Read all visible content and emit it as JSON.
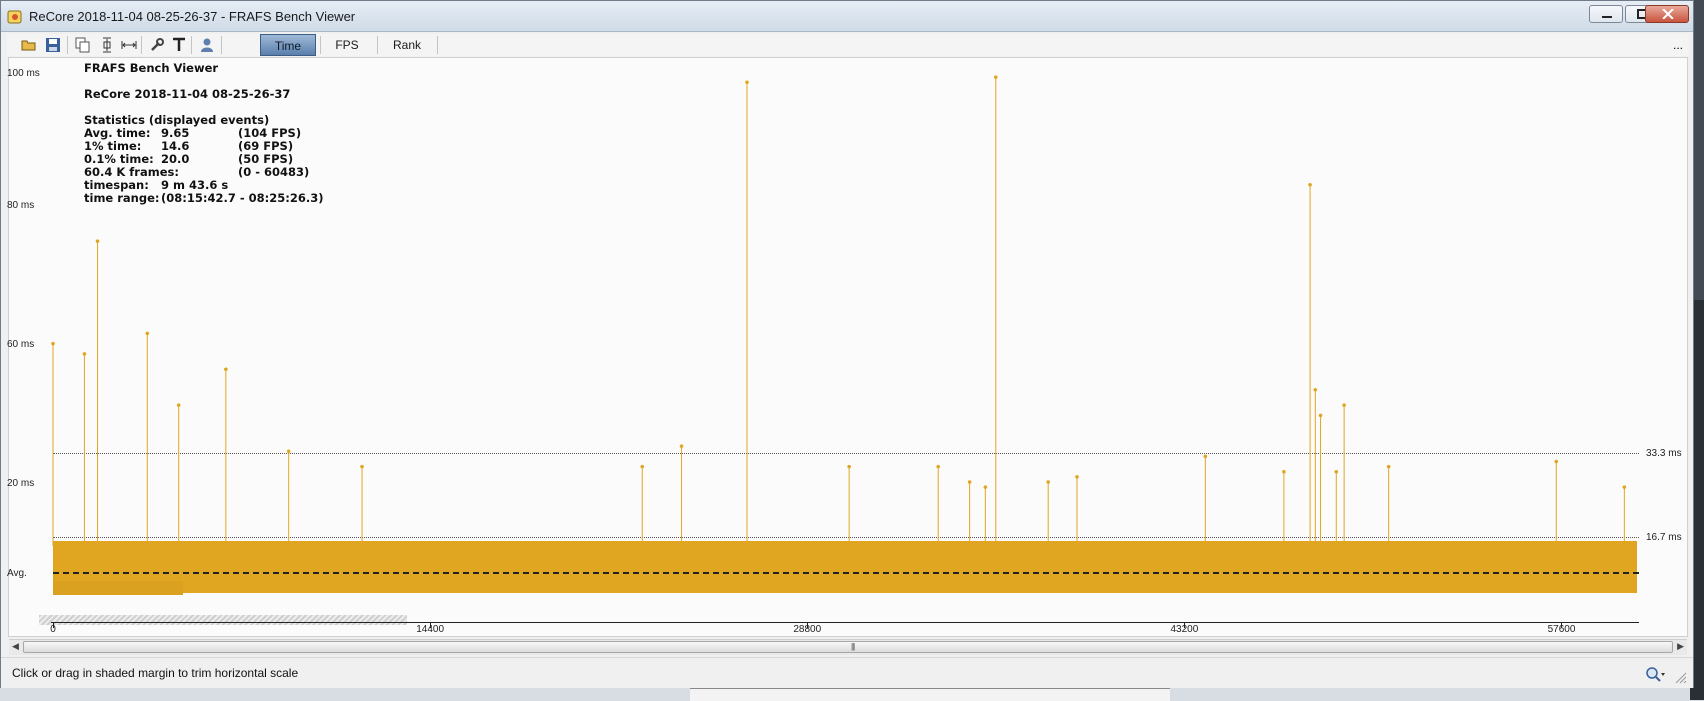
{
  "window": {
    "title": "ReCore 2018-11-04 08-25-26-37 - FRAFS Bench Viewer"
  },
  "toolbar": {
    "icons": [
      "open-folder-icon",
      "save-icon",
      "copy-icon",
      "fit-vertical-icon",
      "fit-horizontal-icon",
      "wrench-icon",
      "text-icon",
      "user-icon"
    ],
    "tabs": [
      {
        "label": "Time",
        "active": true
      },
      {
        "label": "FPS",
        "active": false
      },
      {
        "label": "Rank",
        "active": false
      }
    ],
    "more": "..."
  },
  "info": {
    "title": "FRAFS Bench Viewer",
    "run": "ReCore 2018-11-04 08-25-26-37",
    "stats_heading": "Statistics (displayed events)",
    "rows": [
      {
        "label": "Avg. time:",
        "value": "9.65",
        "extra": "(104 FPS)"
      },
      {
        "label": "1% time:",
        "value": "14.6",
        "extra": "(69 FPS)"
      },
      {
        "label": "0.1% time:",
        "value": "20.0",
        "extra": "(50 FPS)"
      },
      {
        "label": "60.4 K frames:",
        "value": "",
        "extra": "(0 - 60483)"
      },
      {
        "label": "timespan:",
        "value": "9 m 43.6 s",
        "extra": ""
      },
      {
        "label": "time range:",
        "value": "(08:15:42.7 - 08:25:26.3)",
        "extra": ""
      }
    ]
  },
  "chart_data": {
    "type": "scatter",
    "title": "",
    "y_tick_labels": [
      "100 ms",
      "80 ms",
      "60 ms",
      "20 ms",
      "Avg."
    ],
    "x_ticks": [
      0,
      14400,
      28800,
      43200,
      57600
    ],
    "xlim": [
      0,
      60483
    ],
    "reference_lines": [
      {
        "label": "33.3 ms",
        "value": 33.3
      },
      {
        "label": "16.7 ms",
        "value": 16.7
      }
    ],
    "avg_line": 9.65,
    "series": [
      {
        "x": [
          0,
          1200,
          1700,
          3600,
          4800,
          6600,
          9000,
          11800,
          22500,
          24000,
          26500,
          30400,
          33800,
          35000,
          35600,
          36000,
          38000,
          39100,
          44000,
          47000,
          48000,
          48200,
          48400,
          49000,
          49300,
          51000,
          57400,
          60000
        ],
        "y": [
          47,
          45,
          67,
          49,
          35,
          42,
          26,
          23,
          23,
          27,
          98,
          23,
          23,
          20,
          19,
          99,
          20,
          21,
          25,
          22,
          78,
          38,
          33,
          22,
          35,
          23,
          24,
          19
        ]
      }
    ]
  },
  "status": {
    "message": "Click or drag in shaded margin to trim horizontal scale"
  },
  "colors": {
    "series": "#e0a622",
    "active_tab": "#6a8ebb"
  }
}
